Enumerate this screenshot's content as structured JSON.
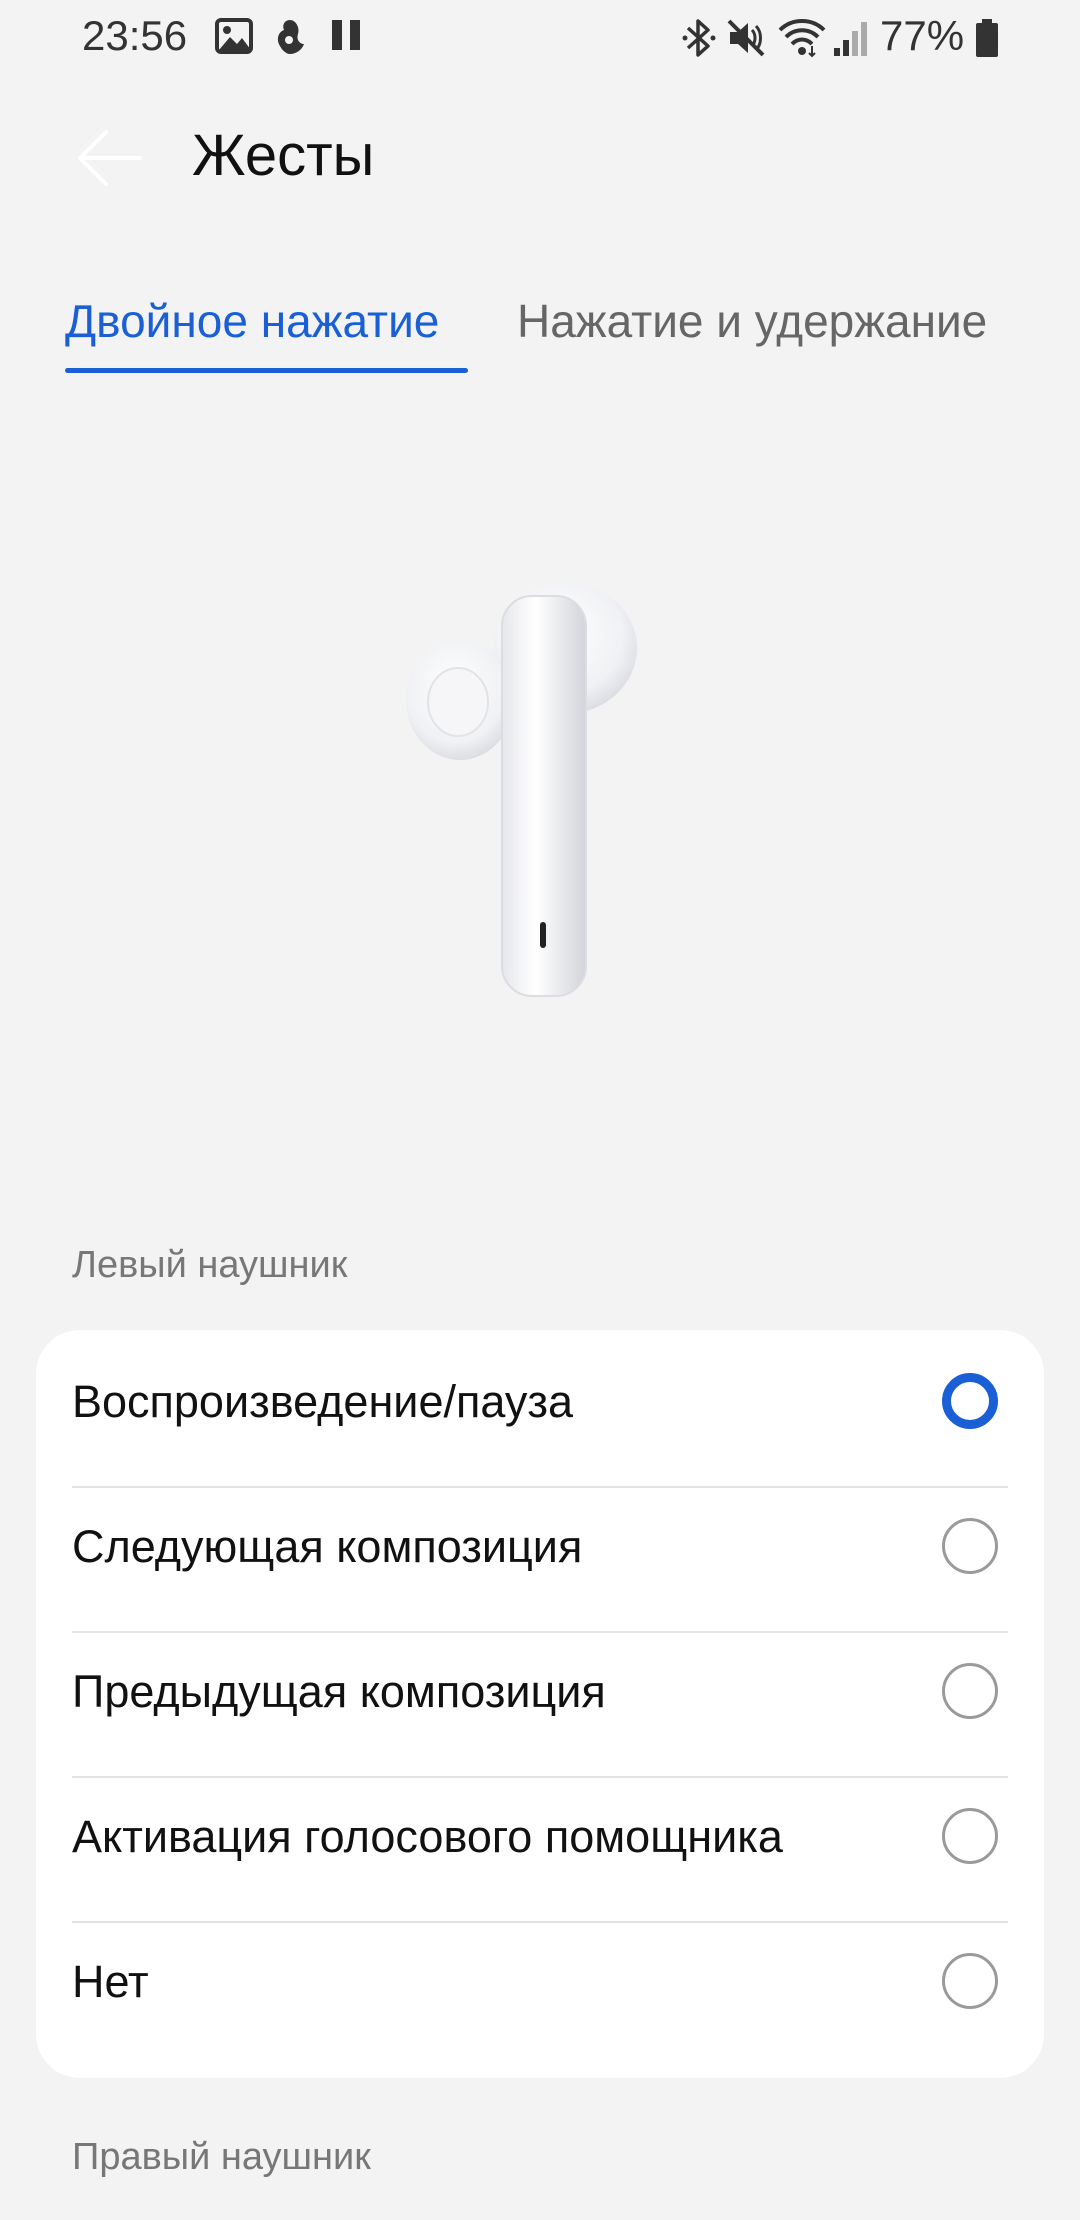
{
  "status_bar": {
    "time": "23:56",
    "battery_percent": "77%",
    "icons": [
      "gallery-icon",
      "app-notification-icon",
      "pause-icon",
      "bluetooth-icon",
      "mute-icon",
      "wifi-icon",
      "signal-icon",
      "battery-icon"
    ]
  },
  "header": {
    "title": "Жесты",
    "back_icon": "arrow-left-icon"
  },
  "tabs": [
    {
      "label": "Двойное нажатие",
      "active": true
    },
    {
      "label": "Нажатие и удержание",
      "active": false
    }
  ],
  "accent_color": "#1a5fd6",
  "left_earbud": {
    "section_label": "Левый наушник",
    "options": [
      {
        "label": "Воспроизведение/пауза",
        "selected": true
      },
      {
        "label": "Следующая композиция",
        "selected": false
      },
      {
        "label": "Предыдущая композиция",
        "selected": false
      },
      {
        "label": "Активация голосового помощника",
        "selected": false
      },
      {
        "label": "Нет",
        "selected": false
      }
    ]
  },
  "right_earbud": {
    "section_label": "Правый наушник"
  }
}
